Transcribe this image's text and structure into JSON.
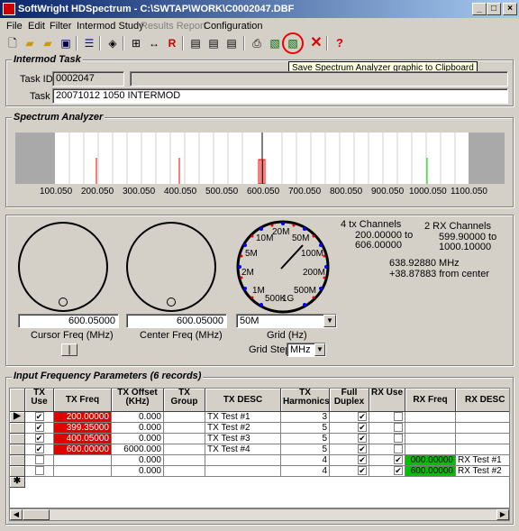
{
  "window": {
    "title": "SoftWright HDSpectrum - C:\\SWTAP\\WORK\\C0002047.DBF",
    "min": "_",
    "max": "□",
    "close": "×"
  },
  "menu": [
    {
      "label": "File"
    },
    {
      "label": "Edit"
    },
    {
      "label": "Filter"
    },
    {
      "label": "Intermod Study"
    },
    {
      "label": "Results Report",
      "disabled": true
    },
    {
      "label": "Configuration"
    }
  ],
  "tooltip": "Save Spectrum Analyzer graphic to Clipboard",
  "task": {
    "title": "Intermod Task",
    "id_label": "Task ID:",
    "id_value": "0002047",
    "task_label": "Task",
    "task_value": "20071012 1050 INTERMOD"
  },
  "spectrum": {
    "title": "Spectrum Analyzer",
    "ticks": [
      "100.050",
      "200.050",
      "300.050",
      "400.050",
      "500.050",
      "600.050",
      "700.050",
      "800.050",
      "900.050",
      "1000.050",
      "1100.050"
    ]
  },
  "controls": {
    "cursor_freq": "600.05000",
    "cursor_label": "Cursor Freq (MHz)",
    "center_freq": "600.05000",
    "center_label": "Center Freq (MHz)",
    "grid_value": "50M",
    "grid_label": "Grid (Hz)",
    "grid_step_label": "Grid Step",
    "grid_step_value": "MHz",
    "dial_labels": [
      "10M",
      "20M",
      "50M",
      "5M",
      "100M",
      "2M",
      "200M",
      "1M",
      "500M",
      "500K",
      "1G"
    ],
    "tx_channels": "4 tx Channels",
    "tx_range1": "200.00000 to",
    "tx_range2": "606.00000",
    "rx_channels": "2 RX Channels",
    "rx_range1": "599.90000 to",
    "rx_range2": "1000.10000",
    "freq_readout": "638.92880 MHz",
    "offset_readout": "+38.87883 from center"
  },
  "table": {
    "title": "Input Frequency Parameters (6 records)",
    "headers": [
      "TX Use",
      "TX Freq",
      "TX Offset (KHz)",
      "TX Group",
      "TX DESC",
      "TX Harmonics",
      "Full Duplex",
      "RX Use",
      "RX Freq",
      "RX DESC"
    ],
    "rows": [
      {
        "tx_use": true,
        "tx_freq": "200.00000",
        "tx_off": "0.000",
        "tx_desc": "TX Test #1",
        "harm": "3",
        "duplex": true,
        "rx_use": false,
        "rx_freq": "",
        "rx_desc": ""
      },
      {
        "tx_use": true,
        "tx_freq": "399.35000",
        "tx_off": "0.000",
        "tx_desc": "TX Test #2",
        "harm": "5",
        "duplex": true,
        "rx_use": false,
        "rx_freq": "",
        "rx_desc": ""
      },
      {
        "tx_use": true,
        "tx_freq": "400.05000",
        "tx_off": "0.000",
        "tx_desc": "TX Test #3",
        "harm": "5",
        "duplex": true,
        "rx_use": false,
        "rx_freq": "",
        "rx_desc": ""
      },
      {
        "tx_use": true,
        "tx_freq": "600.00000",
        "tx_off": "6000.000",
        "tx_desc": "TX Test #4",
        "harm": "5",
        "duplex": true,
        "rx_use": false,
        "rx_freq": "",
        "rx_desc": ""
      },
      {
        "tx_use": false,
        "tx_freq": "",
        "tx_off": "0.000",
        "tx_desc": "",
        "harm": "4",
        "duplex": true,
        "rx_use": true,
        "rx_freq": "000.00000",
        "rx_desc": "RX Test #1"
      },
      {
        "tx_use": false,
        "tx_freq": "",
        "tx_off": "0.000",
        "tx_desc": "",
        "harm": "4",
        "duplex": true,
        "rx_use": true,
        "rx_freq": "600.00000",
        "rx_desc": "RX Test #2"
      }
    ]
  },
  "colors": {
    "tx_highlight": "#e00000",
    "rx_highlight": "#00c000",
    "title_bar": "#0a246a"
  }
}
